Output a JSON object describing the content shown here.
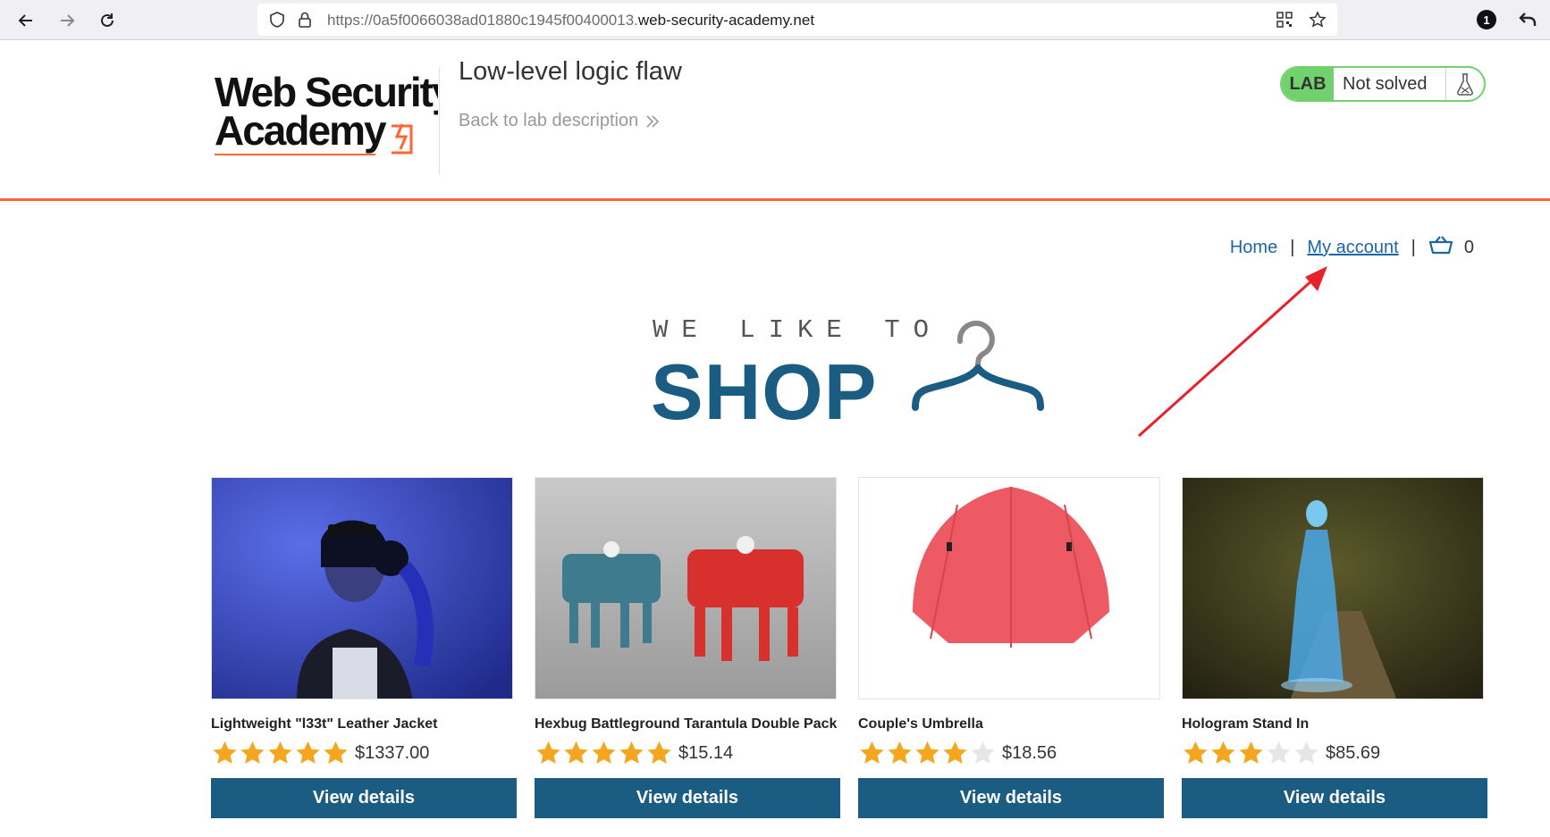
{
  "browser": {
    "url_prefix": "https://0a5f0066038ad01880c1945f00400013.",
    "url_domain": "web-security-academy.net",
    "notification_count": "1"
  },
  "header": {
    "logo_text_line1": "Web Security",
    "logo_text_line2": "Academy",
    "lab_title": "Low-level logic flaw",
    "back_link": "Back to lab description",
    "badge_label": "LAB",
    "status": "Not solved",
    "accent_color": "#ff6633",
    "status_color": "#70d16d"
  },
  "nav": {
    "home": "Home",
    "separator": "|",
    "my_account": "My account",
    "cart_count": "0"
  },
  "banner": {
    "line1": "WE LIKE TO",
    "line2": "SHOP",
    "brand_color": "#1b5c82"
  },
  "products": [
    {
      "name": "Lightweight \"l33t\" Leather Jacket",
      "price": "$1337.00",
      "rating": 5,
      "button": "View details"
    },
    {
      "name": "Hexbug Battleground Tarantula Double Pack",
      "price": "$15.14",
      "rating": 5,
      "button": "View details"
    },
    {
      "name": "Couple's Umbrella",
      "price": "$18.56",
      "rating": 4,
      "button": "View details"
    },
    {
      "name": "Hologram Stand In",
      "price": "$85.69",
      "rating": 3,
      "button": "View details"
    }
  ]
}
